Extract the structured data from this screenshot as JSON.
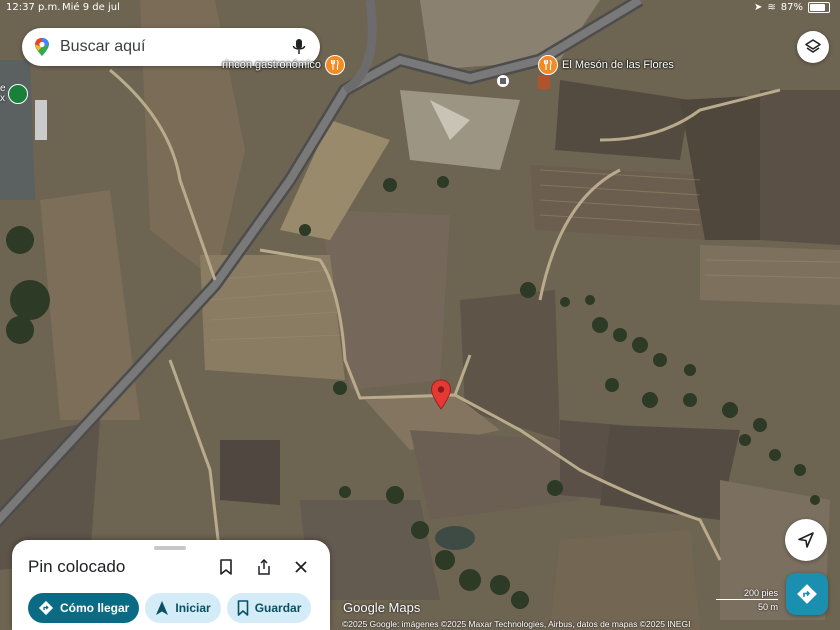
{
  "status_bar": {
    "time": "12:37 p.m.",
    "date": "Mié 9 de jul",
    "battery": "87%"
  },
  "search": {
    "placeholder": "Buscar aquí"
  },
  "pois": [
    {
      "name": "rincon gastronómico"
    },
    {
      "name": "El Mesón de las Flores"
    }
  ],
  "partial_label": "e\nx",
  "sheet": {
    "title": "Pin colocado",
    "actions": {
      "directions": "Cómo llegar",
      "start": "Iniciar",
      "save": "Guardar"
    }
  },
  "map": {
    "brand": "Google Maps",
    "attribution": "©2025 Google: imágenes ©2025 Maxar Technologies, Airbus, datos de mapas ©2025 INEGI",
    "scale": {
      "imperial": "200 pies",
      "metric": "50 m"
    }
  },
  "icons": {
    "maps_logo": "google-maps-pin-icon",
    "mic": "mic-icon",
    "layers": "layers-icon",
    "location": "navigation-arrow-icon",
    "directions": "directions-icon",
    "bookmark": "bookmark-icon",
    "share": "share-icon",
    "close": "close-icon",
    "pin": "red-pin-icon"
  },
  "colors": {
    "pin": "#e53935",
    "primary_chip": "#0b6b84",
    "secondary_chip": "#d3ecf7",
    "poi": "#f28b22"
  }
}
